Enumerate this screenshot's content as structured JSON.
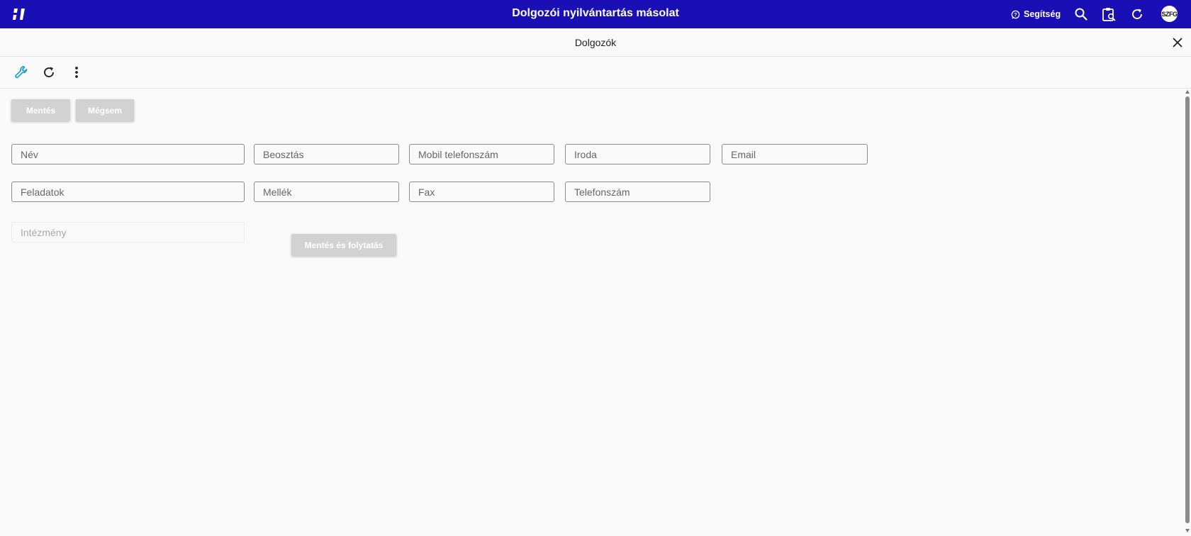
{
  "app": {
    "title": "Dolgozói nyilvántartás másolat",
    "help_label": "Segítség",
    "avatar_initials": "SZFG",
    "accent_color": "#1a0fb5"
  },
  "icons": {
    "logo": "app-logo-icon",
    "help": "help-circle-icon",
    "search": "search-icon",
    "clipboard_search": "clipboard-search-icon",
    "refresh": "refresh-icon",
    "close": "close-icon",
    "wrench": "wrench-icon",
    "more": "more-vertical-icon"
  },
  "page": {
    "title": "Dolgozók"
  },
  "form": {
    "save_label": "Mentés",
    "cancel_label": "Mégsem",
    "save_continue_label": "Mentés és folytatás",
    "fields": {
      "nev": "Név",
      "beosztas": "Beosztás",
      "mobil": "Mobil telefonszám",
      "iroda": "Iroda",
      "email": "Email",
      "feladatok": "Feladatok",
      "mellek": "Mellék",
      "fax": "Fax",
      "telefonszam": "Telefonszám",
      "intezmeny": "Intézmény"
    }
  }
}
